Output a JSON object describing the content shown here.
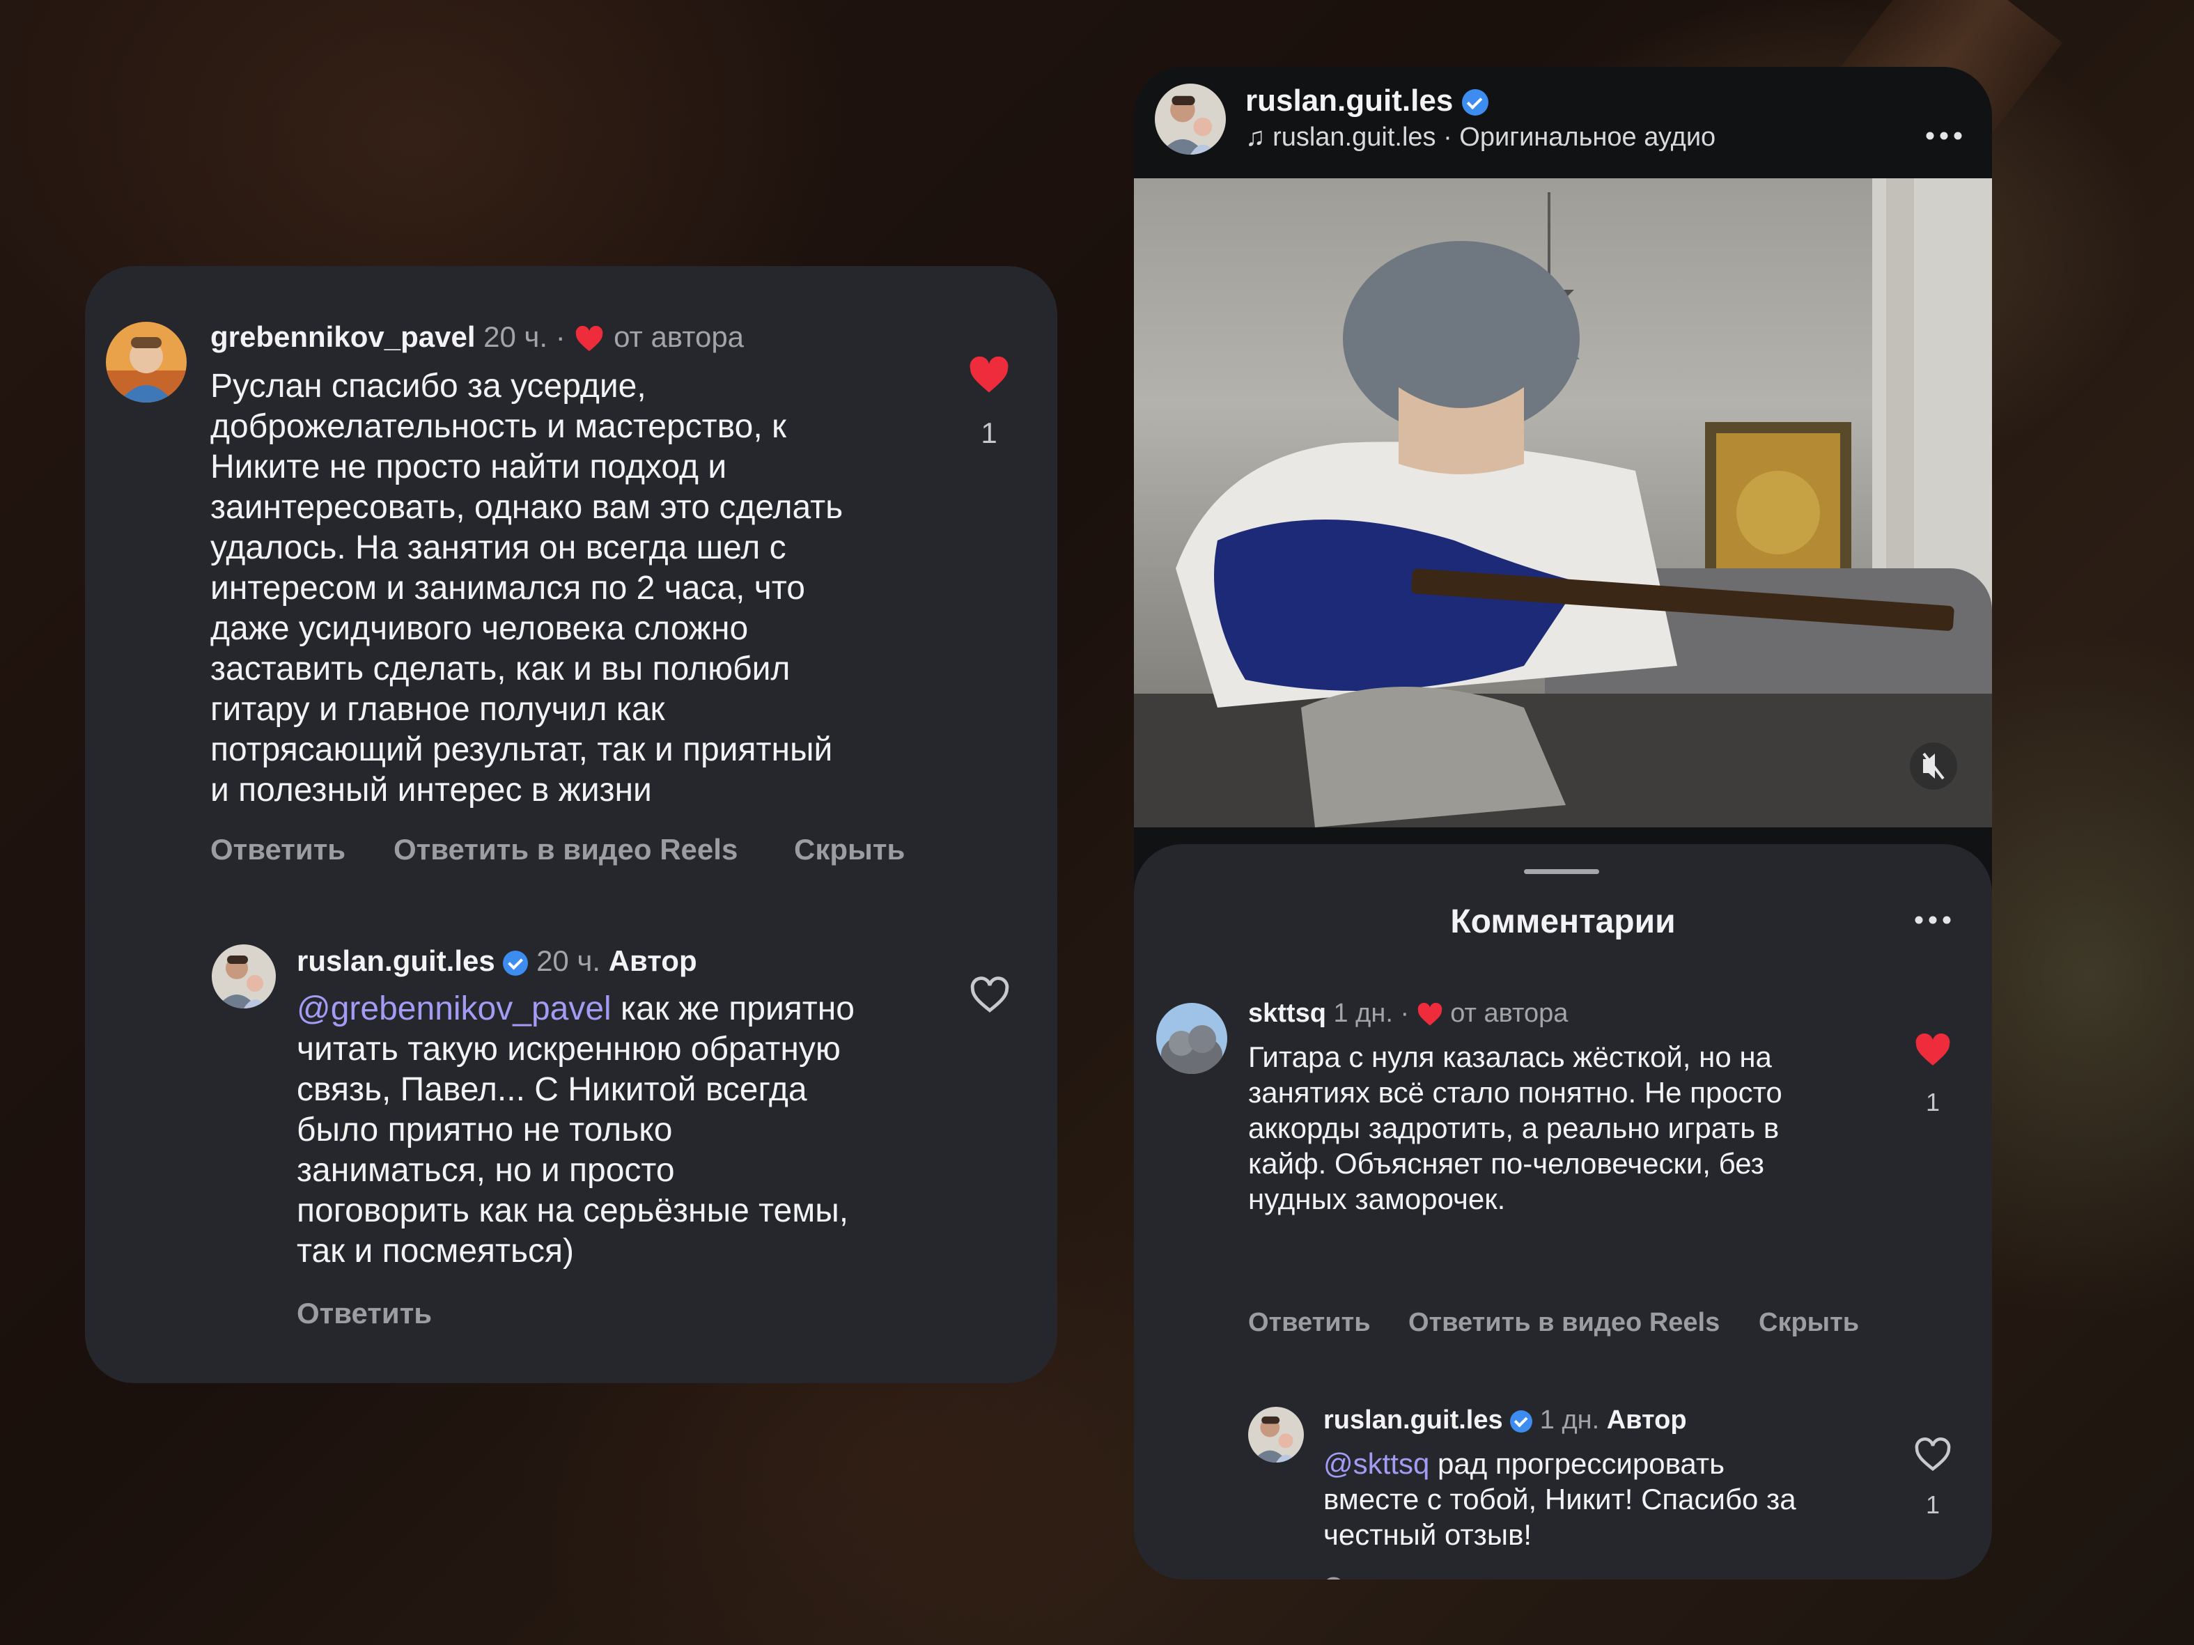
{
  "left_card": {
    "comment": {
      "username": "grebennikov_pavel",
      "time": "20 ч.",
      "dot": "·",
      "author_like_label": "от автора",
      "text": "Руслан спасибо за усердие,\nдоброжелательность и мастерство, к\nНиките не просто найти подход и\nзаинтересовать, однако вам это сделать\nудалось. На занятия он всегда шел с\nинтересом и занимался по 2 часа, что\nдаже усидчивого человека сложно\nзаставить сделать, как и вы полюбил\nгитару и главное получил как\nпотрясающий результат, так и приятный\nи полезный интерес в жизни",
      "like_count": "1",
      "actions": [
        "Ответить",
        "Ответить в видео Reels",
        "Скрыть"
      ]
    },
    "reply": {
      "username": "ruslan.guit.les",
      "time": "20 ч.",
      "author_label": "Автор",
      "mention": "@grebennikov_pavel",
      "text_first": " как же приятно",
      "text_rest": "читать такую искреннюю обратную\nсвязь, Павел... С Никитой всегда\nбыло приятно не только\nзаниматься, но и просто\nпоговорить как на серьёзные темы,\nтак и посмеяться)",
      "action": "Ответить"
    }
  },
  "right_card": {
    "header": {
      "username": "ruslan.guit.les",
      "audio": "ruslan.guit.les · Оригинальное аудио"
    },
    "comments_title": "Комментарии",
    "comment": {
      "username": "skttsq",
      "time": "1 дн.",
      "dot": "·",
      "author_like_label": "от автора",
      "text": "Гитара с нуля казалась жёсткой, но на\nзанятиях всё стало понятно. Не просто\nаккорды задротить, а реально играть в\nкайф. Объясняет по-человечески, без\nнудных заморочек.",
      "like_count": "1",
      "actions": [
        "Ответить",
        "Ответить в видео Reels",
        "Скрыть"
      ]
    },
    "reply": {
      "username": "ruslan.guit.les",
      "time": "1 дн.",
      "author_label": "Автор",
      "mention": "@skttsq",
      "text_first": " рад прогрессировать",
      "text_rest": "вместе с тобой, Никит! Спасибо за\nчестный отзыв!",
      "like_count": "1",
      "action": "Ответить"
    }
  },
  "colors": {
    "card_bg": "#25272c",
    "heart_red": "#ee2c3c",
    "verified_blue": "#3d8cf0",
    "mention": "#a39cf4"
  }
}
